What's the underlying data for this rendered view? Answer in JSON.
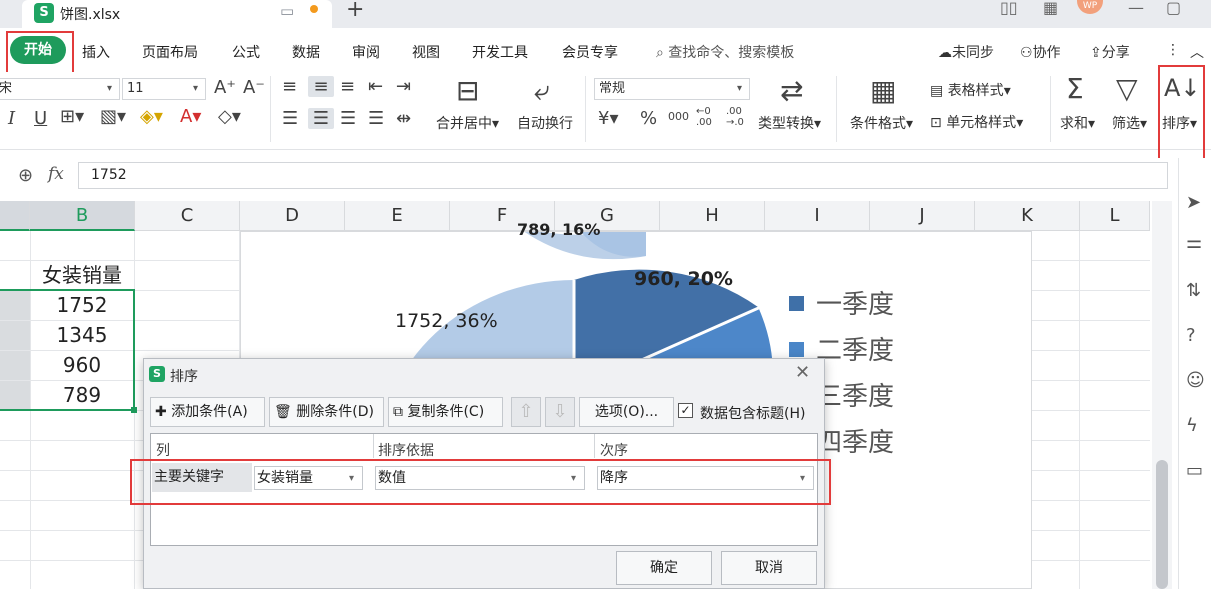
{
  "titlebar": {
    "file_name": "饼图.xlsx",
    "file_icon": "S",
    "avatar": "WP"
  },
  "menu": {
    "home": "开始",
    "items": [
      "插入",
      "页面布局",
      "公式",
      "数据",
      "审阅",
      "视图",
      "开发工具",
      "会员专享"
    ],
    "search_placeholder": "查找命令、搜索模板",
    "sync": "未同步",
    "collab": "协作",
    "share": "分享"
  },
  "ribbon": {
    "font_name": "宋",
    "font_size": "11",
    "merge_center": "合并居中",
    "wrap_text": "自动换行",
    "number_format": "常规",
    "type_convert": "类型转换",
    "cond_format": "条件格式",
    "table_style": "表格样式",
    "cell_style": "单元格样式",
    "sum": "求和",
    "filter": "筛选",
    "sort": "排序",
    "currency_symbol": "¥",
    "percent_symbol": "%",
    "thousands_symbol": "000",
    "dec_inc": "←0 .00",
    "dec_dec": ".00 →.0"
  },
  "formula": {
    "fx": "fx",
    "value": "1752"
  },
  "columns": [
    "B",
    "C",
    "D",
    "E",
    "F",
    "G",
    "H",
    "I",
    "J",
    "K",
    "L"
  ],
  "sheet": {
    "header_cell": "女装销量",
    "values": [
      "1752",
      "1345",
      "960",
      "789"
    ]
  },
  "chart": {
    "labels": [
      "1752, 36%",
      "960, 20%",
      "789, 16%"
    ],
    "legend": [
      "一季度",
      "二季度",
      "三季度",
      "四季度"
    ],
    "colors": {
      "q1": "#3f70a8",
      "q2": "#4a86c8",
      "q3": "#a9c4e4",
      "q4": "#bcd0e8"
    }
  },
  "dialog": {
    "title": "排序",
    "logo": "S",
    "add": "添加条件(A)",
    "delete": "删除条件(D)",
    "copy": "复制条件(C)",
    "up_arrow": "⇧",
    "down_arrow": "⇩",
    "options": "选项(O)...",
    "has_header": "数据包含标题(H)",
    "col_header": "列",
    "basis_header": "排序依据",
    "order_header": "次序",
    "primary_key": "主要关键字",
    "key_value": "女装销量",
    "basis_value": "数值",
    "order_value": "降序",
    "ok": "确定",
    "cancel": "取消"
  }
}
